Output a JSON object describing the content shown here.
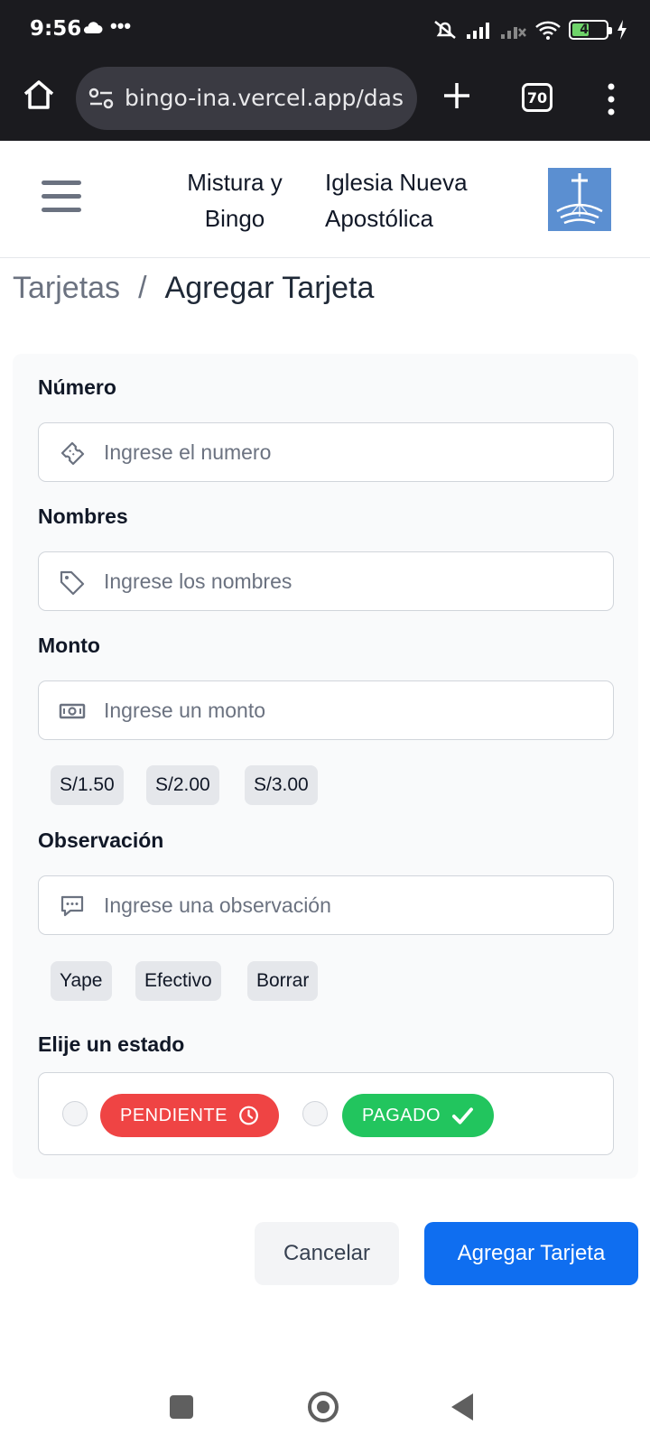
{
  "status_bar": {
    "time": "9:56",
    "dots": "•••",
    "battery_level": "46"
  },
  "browser": {
    "url": "bingo-ina.vercel.app/das",
    "tab_count": "70"
  },
  "header": {
    "title_line1": "Mistura y",
    "title_line2": "Bingo",
    "org_line1": "Iglesia Nueva",
    "org_line2": "Apostólica"
  },
  "breadcrumb": {
    "parent": "Tarjetas",
    "separator": "/",
    "current": "Agregar Tarjeta"
  },
  "form": {
    "numero": {
      "label": "Número",
      "placeholder": "Ingrese el numero"
    },
    "nombres": {
      "label": "Nombres",
      "placeholder": "Ingrese los nombres"
    },
    "monto": {
      "label": "Monto",
      "placeholder": "Ingrese un monto",
      "quick_amounts": [
        "S/1.50",
        "S/2.00",
        "S/3.00"
      ]
    },
    "observacion": {
      "label": "Observación",
      "placeholder": "Ingrese una observación",
      "quick_options": [
        "Yape",
        "Efectivo",
        "Borrar"
      ]
    },
    "estado": {
      "label": "Elije un estado",
      "options": [
        {
          "label": "PENDIENTE",
          "color": "#ef4444",
          "icon": "clock-icon"
        },
        {
          "label": "PAGADO",
          "color": "#22c55e",
          "icon": "check-icon"
        }
      ]
    }
  },
  "actions": {
    "cancel": "Cancelar",
    "submit": "Agregar Tarjeta"
  },
  "colors": {
    "primary": "#0f6ef0",
    "pending": "#ef4444",
    "paid": "#22c55e"
  }
}
